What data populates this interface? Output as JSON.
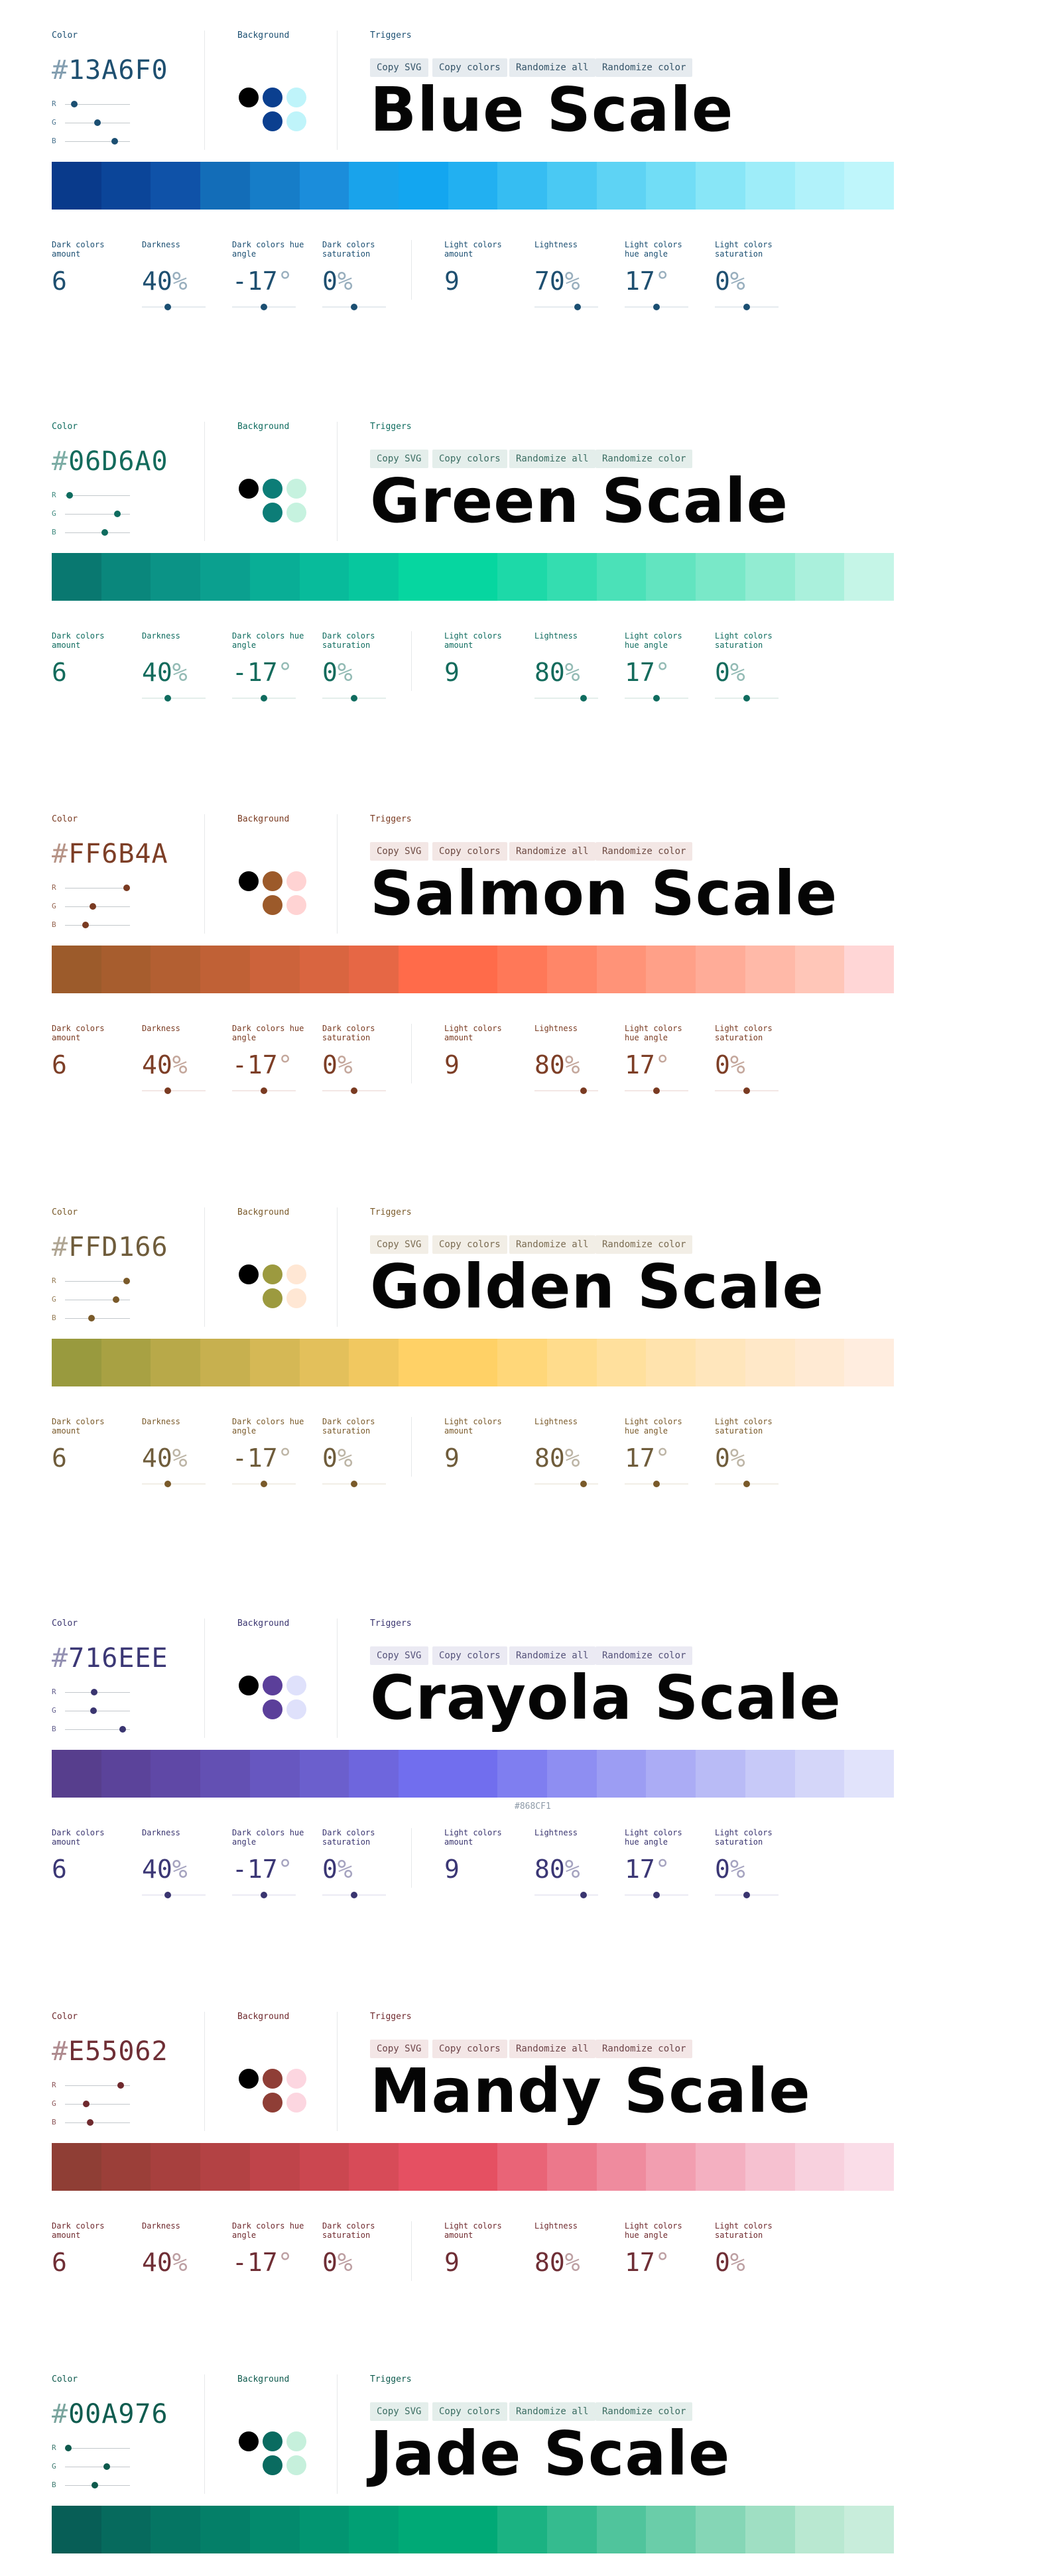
{
  "labels": {
    "color": "Color",
    "background": "Background",
    "triggers": "Triggers",
    "r": "R",
    "g": "G",
    "b": "B"
  },
  "triggers": [
    "Copy SVG",
    "Copy colors",
    "Randomize all",
    "Randomize color"
  ],
  "param_labels": [
    "Dark colors amount",
    "Darkness",
    "Dark colors hue angle",
    "Dark colors saturation",
    "Light colors amount",
    "Lightness",
    "Light colors hue angle",
    "Light colors saturation"
  ],
  "scales": [
    {
      "name": "Blue Scale",
      "hex": "13A6F0",
      "accent": "#1b4f72",
      "text_color": "#1e4f70",
      "chip_bg": "#e6ebef",
      "chip_text": "#355468",
      "rgb_levels": [
        0.1,
        0.5,
        0.8
      ],
      "background_dots": [
        "#000000",
        "#0b3f8f",
        "#bff4fa",
        "#0b3f8f",
        "#bff4fa"
      ],
      "swatches": [
        "#093a8b",
        "#0b4599",
        "#0f52a8",
        "#136db8",
        "#167dc8",
        "#1b8ddb",
        "#19a3eb",
        "#13a6f0",
        "#22b0f1",
        "#36bdf2",
        "#4ac9f3",
        "#5ed3f4",
        "#71ddf6",
        "#88e6f7",
        "#9eedf9",
        "#b1f2fa",
        "#bff6fb"
      ],
      "caption": "",
      "params": [
        {
          "value": "6",
          "unit": "",
          "level": null
        },
        {
          "value": "40",
          "unit": "%",
          "level": 0.4
        },
        {
          "value": "-17",
          "unit": "°",
          "level": 0.5
        },
        {
          "value": "0",
          "unit": "%",
          "level": 0.5
        },
        {
          "value": "9",
          "unit": "",
          "level": null
        },
        {
          "value": "70",
          "unit": "%",
          "level": 0.7
        },
        {
          "value": "17",
          "unit": "°",
          "level": 0.5
        },
        {
          "value": "0",
          "unit": "%",
          "level": 0.5
        }
      ]
    },
    {
      "name": "Green Scale",
      "hex": "06D6A0",
      "accent": "#0f6c5f",
      "text_color": "#136b5c",
      "chip_bg": "#e4eeeb",
      "chip_text": "#3b6d62",
      "rgb_levels": [
        0.02,
        0.84,
        0.63
      ],
      "background_dots": [
        "#000000",
        "#0c7d77",
        "#c6f2df",
        "#0c7d77",
        "#c6f2df"
      ],
      "swatches": [
        "#097870",
        "#0a877c",
        "#0b9386",
        "#0ba08f",
        "#09ae96",
        "#08bb9b",
        "#07c79e",
        "#06d6a0",
        "#06d6a0",
        "#1dd9a8",
        "#34ddb0",
        "#4be1b8",
        "#62e4c0",
        "#79e8c8",
        "#92ecd2",
        "#aaf0dc",
        "#c5f5e7"
      ],
      "caption": "",
      "params": [
        {
          "value": "6",
          "unit": "",
          "level": null
        },
        {
          "value": "40",
          "unit": "%",
          "level": 0.4
        },
        {
          "value": "-17",
          "unit": "°",
          "level": 0.5
        },
        {
          "value": "0",
          "unit": "%",
          "level": 0.5
        },
        {
          "value": "9",
          "unit": "",
          "level": null
        },
        {
          "value": "80",
          "unit": "%",
          "level": 0.8
        },
        {
          "value": "17",
          "unit": "°",
          "level": 0.5
        },
        {
          "value": "0",
          "unit": "%",
          "level": 0.5
        }
      ]
    },
    {
      "name": "Salmon Scale",
      "hex": "FF6B4A",
      "accent": "#7a3b22",
      "text_color": "#7d3e26",
      "chip_bg": "#f3e7e5",
      "chip_text": "#6d4a42",
      "rgb_levels": [
        1.0,
        0.42,
        0.29
      ],
      "background_dots": [
        "#000000",
        "#9c5a2a",
        "#ffd3d3",
        "#9c5a2a",
        "#ffd3d3"
      ],
      "swatches": [
        "#9c5b2b",
        "#a75d2e",
        "#b35f32",
        "#c06136",
        "#cc633b",
        "#d96540",
        "#e66745",
        "#ff6b4a",
        "#ff6b4a",
        "#ff7858",
        "#ff8668",
        "#ff9378",
        "#ffa088",
        "#ffac98",
        "#ffb9a8",
        "#ffc6b8",
        "#ffd6d6"
      ],
      "caption": "",
      "params": [
        {
          "value": "6",
          "unit": "",
          "level": null
        },
        {
          "value": "40",
          "unit": "%",
          "level": 0.4
        },
        {
          "value": "-17",
          "unit": "°",
          "level": 0.5
        },
        {
          "value": "0",
          "unit": "%",
          "level": 0.5
        },
        {
          "value": "9",
          "unit": "",
          "level": null
        },
        {
          "value": "80",
          "unit": "%",
          "level": 0.8
        },
        {
          "value": "17",
          "unit": "°",
          "level": 0.5
        },
        {
          "value": "0",
          "unit": "%",
          "level": 0.5
        }
      ]
    },
    {
      "name": "Golden Scale",
      "hex": "FFD166",
      "accent": "#7a5a2a",
      "text_color": "#6f5c3b",
      "chip_bg": "#f2eee6",
      "chip_text": "#7b6c52",
      "rgb_levels": [
        1.0,
        0.82,
        0.4
      ],
      "background_dots": [
        "#000000",
        "#9c9a3f",
        "#ffe7d4",
        "#9c9a3f",
        "#ffe7d4"
      ],
      "swatches": [
        "#999a3e",
        "#a8a143",
        "#b8a949",
        "#c7b04f",
        "#d5b855",
        "#e3c05b",
        "#f1c860",
        "#ffd166",
        "#ffd166",
        "#ffd779",
        "#ffdc8c",
        "#ffe09d",
        "#ffe3ad",
        "#ffe6bc",
        "#ffe8c8",
        "#ffead3",
        "#ffeddf"
      ],
      "caption": "",
      "params": [
        {
          "value": "6",
          "unit": "",
          "level": null
        },
        {
          "value": "40",
          "unit": "%",
          "level": 0.4
        },
        {
          "value": "-17",
          "unit": "°",
          "level": 0.5
        },
        {
          "value": "0",
          "unit": "%",
          "level": 0.5
        },
        {
          "value": "9",
          "unit": "",
          "level": null
        },
        {
          "value": "80",
          "unit": "%",
          "level": 0.8
        },
        {
          "value": "17",
          "unit": "°",
          "level": 0.5
        },
        {
          "value": "0",
          "unit": "%",
          "level": 0.5
        }
      ]
    },
    {
      "name": "Crayola Scale",
      "hex": "716EEE",
      "accent": "#3a3570",
      "text_color": "#3b3775",
      "chip_bg": "#ebeaf3",
      "chip_text": "#55527a",
      "rgb_levels": [
        0.44,
        0.43,
        0.93
      ],
      "background_dots": [
        "#000000",
        "#5b3f9a",
        "#dfe1fb",
        "#5b3f9a",
        "#dfe1fb"
      ],
      "swatches": [
        "#573e8d",
        "#5b439a",
        "#5f48a6",
        "#6350b3",
        "#6757c0",
        "#6b5fcd",
        "#6e66dd",
        "#716eee",
        "#716eee",
        "#7f7ef0",
        "#8e8ef2",
        "#9c9df3",
        "#abacf5",
        "#b9bbf6",
        "#c7c9f8",
        "#d4d6f9",
        "#e1e3fb"
      ],
      "caption": "#868CF1",
      "params": [
        {
          "value": "6",
          "unit": "",
          "level": null
        },
        {
          "value": "40",
          "unit": "%",
          "level": 0.4
        },
        {
          "value": "-17",
          "unit": "°",
          "level": 0.5
        },
        {
          "value": "0",
          "unit": "%",
          "level": 0.5
        },
        {
          "value": "9",
          "unit": "",
          "level": null
        },
        {
          "value": "80",
          "unit": "%",
          "level": 0.8
        },
        {
          "value": "17",
          "unit": "°",
          "level": 0.5
        },
        {
          "value": "0",
          "unit": "%",
          "level": 0.5
        }
      ]
    },
    {
      "name": "Mandy Scale",
      "hex": "E55062",
      "accent": "#6f2a2e",
      "text_color": "#6f2e35",
      "chip_bg": "#f3e6e6",
      "chip_text": "#6d4448",
      "rgb_levels": [
        0.9,
        0.31,
        0.38
      ],
      "background_dots": [
        "#000000",
        "#8f3e36",
        "#fcd6e0",
        "#8f3e36",
        "#fcd6e0"
      ],
      "swatches": [
        "#8f3e35",
        "#9b3f39",
        "#a7403e",
        "#b34244",
        "#bf444a",
        "#cb4750",
        "#d74b58",
        "#e55062",
        "#e55062",
        "#e96477",
        "#ec788b",
        "#ef8b9e",
        "#f29eb0",
        "#f4b0c1",
        "#f6c1d0",
        "#f8d1de",
        "#fadde8"
      ],
      "caption": "",
      "params": [
        {
          "value": "6",
          "unit": "",
          "level": null
        },
        {
          "value": "40",
          "unit": "%",
          "level": null
        },
        {
          "value": "-17",
          "unit": "°",
          "level": null
        },
        {
          "value": "0",
          "unit": "%",
          "level": null
        },
        {
          "value": "9",
          "unit": "",
          "level": null
        },
        {
          "value": "80",
          "unit": "%",
          "level": null
        },
        {
          "value": "17",
          "unit": "°",
          "level": null
        },
        {
          "value": "0",
          "unit": "%",
          "level": null
        }
      ]
    },
    {
      "name": "Jade Scale",
      "hex": "00A976",
      "accent": "#0e5a4d",
      "text_color": "#0f5c4f",
      "chip_bg": "#e4eeeb",
      "chip_text": "#3b6d62",
      "rgb_levels": [
        0.0,
        0.66,
        0.46
      ],
      "background_dots": [
        "#000000",
        "#0a6b60",
        "#c6f0dc",
        "#0a6b60",
        "#c6f0dc"
      ],
      "swatches": [
        "#075e56",
        "#066a5d",
        "#057563",
        "#047f68",
        "#038a6d",
        "#029571",
        "#019f74",
        "#00a976",
        "#00a976",
        "#1bb282",
        "#35bb8f",
        "#50c49c",
        "#6acda9",
        "#85d6b6",
        "#9fdfc3",
        "#b9e8d1",
        "#c8eddb"
      ],
      "caption": "",
      "params": []
    }
  ]
}
